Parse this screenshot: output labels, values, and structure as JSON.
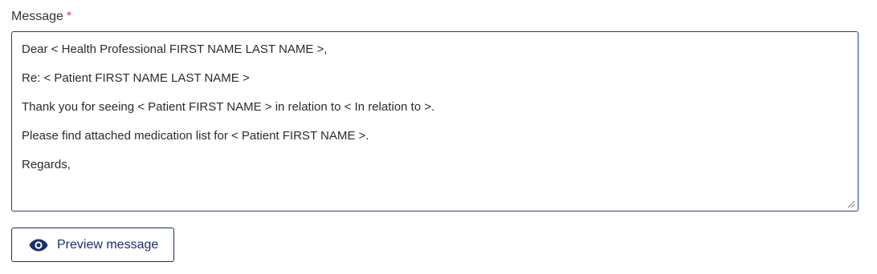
{
  "field": {
    "label": "Message",
    "required_marker": "*",
    "lines": [
      "Dear < Health Professional FIRST NAME LAST NAME >,",
      "Re: < Patient FIRST NAME LAST NAME >",
      "Thank you for seeing < Patient FIRST NAME > in relation to < In relation to >.",
      "Please find attached medication list for < Patient FIRST NAME >.",
      "Regards,"
    ]
  },
  "preview_button": {
    "label": "Preview message",
    "icon": "eye-icon"
  },
  "colors": {
    "accent": "#1a2f6e",
    "border": "#1f3f8f",
    "required": "#d13c3c"
  }
}
